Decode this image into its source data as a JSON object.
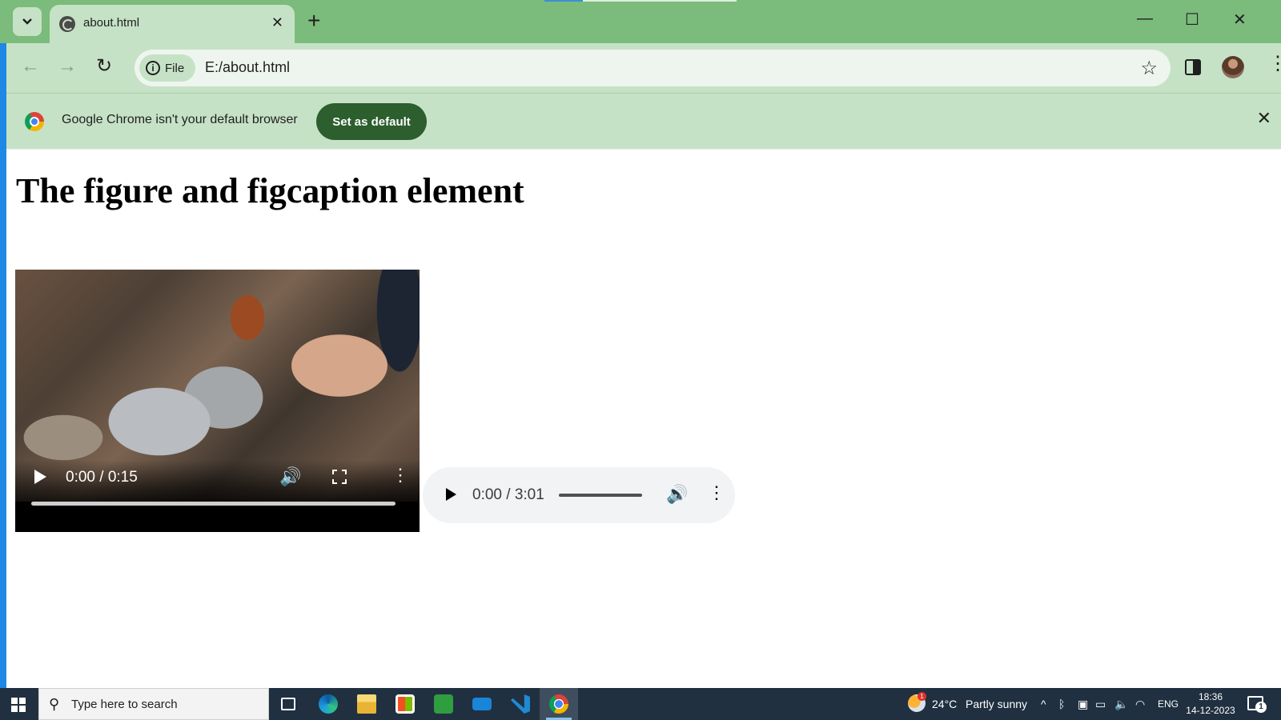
{
  "browser": {
    "tab": {
      "title": "about.html",
      "close": "✕"
    },
    "new_tab": "+",
    "window_controls": {
      "minimize": "—",
      "maximize": "☐",
      "close": "✕"
    },
    "nav": {
      "back": "←",
      "forward": "→",
      "reload": "↻"
    },
    "omnibox": {
      "chip_label": "File",
      "url": "E:/about.html",
      "star": "☆"
    },
    "menu": "⋮",
    "icons": [
      "tab-search-icon",
      "globe-icon",
      "info-icon",
      "star-icon",
      "side-panel-icon",
      "profile-avatar",
      "kebab-menu-icon"
    ]
  },
  "infobar": {
    "message": "Google Chrome isn't your default browser",
    "button_label": "Set as default",
    "close": "✕"
  },
  "page": {
    "heading": "The figure and figcaption element",
    "video": {
      "time": "0:00 / 0:15",
      "volume": "🔊",
      "more": "⋮"
    },
    "audio": {
      "time": "0:00 / 3:01",
      "volume": "🔊",
      "more": "⋮"
    }
  },
  "taskbar": {
    "search_placeholder": "Type here to search",
    "weather": {
      "temperature": "24°C",
      "condition": "Partly sunny",
      "badge": "1"
    },
    "tray": {
      "chevron": "^",
      "language": "ENG"
    },
    "clock": {
      "time": "18:36",
      "date": "14-12-2023"
    },
    "notifications_count": "1",
    "apps": [
      "task-view",
      "edge",
      "file-explorer",
      "microsoft-store",
      "messages",
      "mail",
      "vscode",
      "chrome"
    ]
  },
  "colors": {
    "titlebar": "#7bbb7b",
    "toolbar": "#c6e2c6",
    "set_default_button": "#2c5e2e",
    "taskbar": "#203040",
    "left_edge": "#1e88e5"
  }
}
